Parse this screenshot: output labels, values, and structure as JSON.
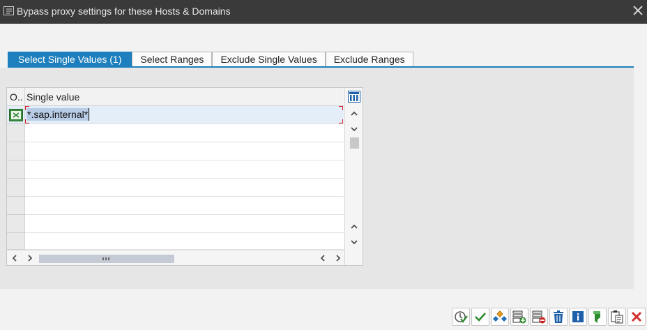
{
  "window": {
    "title": "Bypass proxy settings for these Hosts & Domains"
  },
  "tabs": [
    {
      "label": "Select Single Values (1)",
      "active": true
    },
    {
      "label": "Select Ranges",
      "active": false
    },
    {
      "label": "Exclude Single Values",
      "active": false
    },
    {
      "label": "Exclude Ranges",
      "active": false
    }
  ],
  "table": {
    "columns": {
      "option": "O..",
      "value": "Single value"
    },
    "rows": [
      {
        "value": "*.sap.internal*"
      },
      {
        "value": ""
      },
      {
        "value": ""
      },
      {
        "value": ""
      },
      {
        "value": ""
      },
      {
        "value": ""
      },
      {
        "value": ""
      },
      {
        "value": ""
      }
    ]
  },
  "toolbar": {
    "buttons": [
      "execute-icon",
      "ok-icon",
      "multiple-selection-icon",
      "insert-row-icon",
      "delete-row-icon",
      "delete-all-icon",
      "help-icon",
      "import-icon",
      "paste-icon",
      "cancel-icon"
    ]
  },
  "colors": {
    "accent": "#1d7fbd",
    "titlebar": "#3a3a3a",
    "selection": "#b9cce6",
    "error": "#d21d1d"
  }
}
